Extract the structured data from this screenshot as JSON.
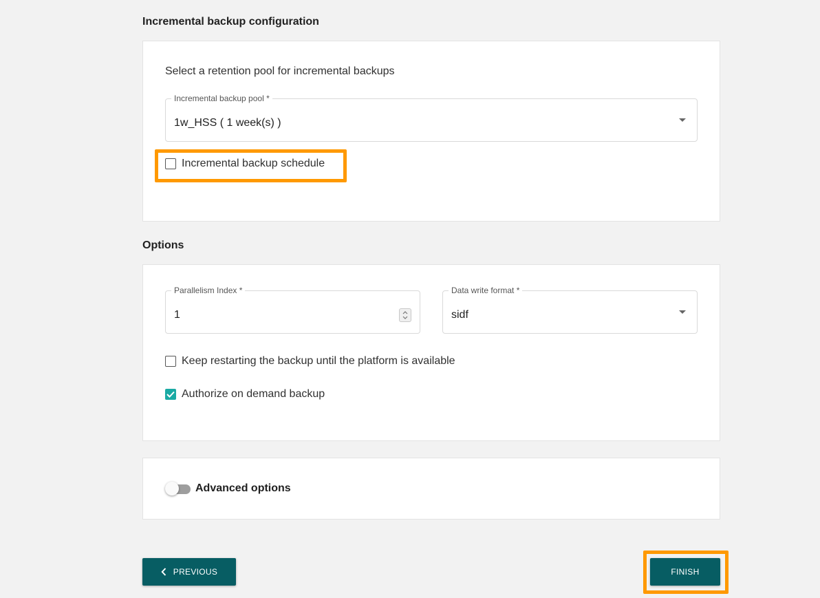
{
  "incremental": {
    "section_title": "Incremental backup configuration",
    "prompt": "Select a retention pool for incremental backups",
    "pool_field": {
      "label": "Incremental backup pool *",
      "value": "1w_HSS ( 1 week(s) )"
    },
    "schedule_checkbox": {
      "label": "Incremental backup schedule",
      "checked": false
    }
  },
  "options": {
    "section_title": "Options",
    "parallelism_field": {
      "label": "Parallelism Index *",
      "value": "1"
    },
    "format_field": {
      "label": "Data write format *",
      "value": "sidf"
    },
    "restart_checkbox": {
      "label": "Keep restarting the backup until the platform is available",
      "checked": false
    },
    "authorize_checkbox": {
      "label": "Authorize on demand backup",
      "checked": true
    }
  },
  "advanced": {
    "label": "Advanced options",
    "enabled": false
  },
  "footer": {
    "previous_label": "PREVIOUS",
    "finish_label": "FINISH"
  },
  "colors": {
    "accent_teal": "#075d63",
    "checkbox_checked": "#1aaaa4",
    "highlight_orange": "#ff9900"
  },
  "icons": {
    "previous": "chevron-left-icon",
    "dropdown": "caret-down-icon",
    "spinner": "number-stepper-icon",
    "checkmark": "checkmark-icon"
  }
}
